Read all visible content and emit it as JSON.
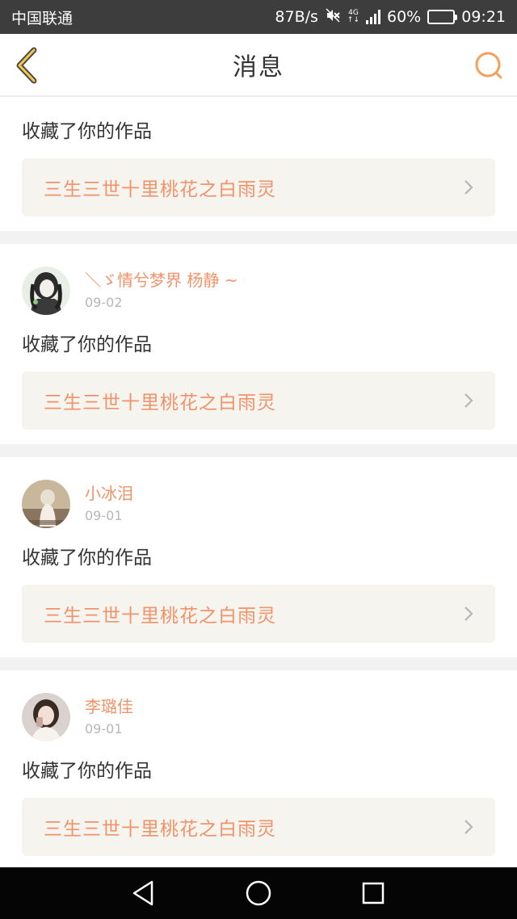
{
  "status_bar": {
    "carrier": "中国联通",
    "speed": "87B/s",
    "network_top": "4G",
    "network_bottom": "↑↓",
    "battery": "60%",
    "time": "09:21",
    "icons": [
      "mute-icon",
      "signal-icon",
      "battery-icon"
    ]
  },
  "header": {
    "title": "消息",
    "back_icon": "chevron-left-icon",
    "search_icon": "search-icon",
    "accent": "#f5a623"
  },
  "colors": {
    "accent": "#f0926a",
    "work_bg": "#f6f4ee",
    "separator": "#f2f2f2"
  },
  "messages": [
    {
      "action": "收藏了你的作品",
      "work_title": "三生三世十里桃花之白雨灵"
    },
    {
      "username": "＼ゞ情兮梦界 杨静 ~",
      "date": "09-02",
      "action": "收藏了你的作品",
      "work_title": "三生三世十里桃花之白雨灵",
      "avatar": "avatar-anime-girl"
    },
    {
      "username": "小冰泪",
      "date": "09-01",
      "action": "收藏了你的作品",
      "work_title": "三生三世十里桃花之白雨灵",
      "avatar": "avatar-dog"
    },
    {
      "username": "李璐佳",
      "date": "09-01",
      "action": "收藏了你的作品",
      "work_title": "三生三世十里桃花之白雨灵",
      "avatar": "avatar-girl-photo"
    }
  ],
  "system_nav": [
    "back-triangle-icon",
    "home-circle-icon",
    "recents-square-icon"
  ]
}
